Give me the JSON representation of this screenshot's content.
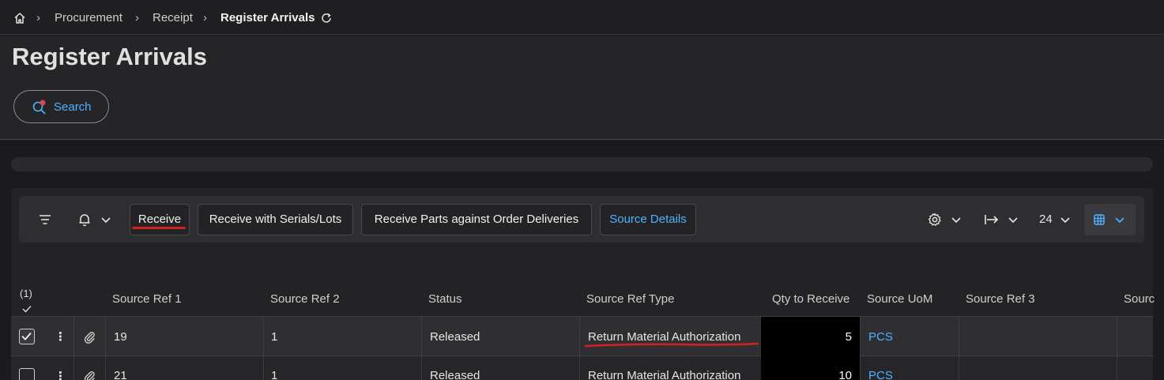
{
  "breadcrumb": {
    "items": [
      "Procurement",
      "Receipt"
    ],
    "current": "Register Arrivals"
  },
  "page": {
    "title": "Register Arrivals"
  },
  "search": {
    "label": "Search"
  },
  "toolbar": {
    "receive": "Receive",
    "receive_serials": "Receive with Serials/Lots",
    "receive_parts": "Receive Parts against Order Deliveries",
    "source_details": "Source Details",
    "page_size": "24"
  },
  "grid": {
    "selected_count": "(1)",
    "columns": [
      "Source Ref 1",
      "Source Ref 2",
      "Status",
      "Source Ref Type",
      "Qty to Receive",
      "Source UoM",
      "Source Ref 3",
      "Sourc"
    ],
    "rows": [
      {
        "checked": true,
        "source_ref_1": "19",
        "source_ref_2": "1",
        "status": "Released",
        "source_ref_type": "Return Material Authorization",
        "qty_to_receive": "5",
        "source_uom": "PCS",
        "source_ref_3": ""
      },
      {
        "checked": false,
        "source_ref_1": "21",
        "source_ref_2": "1",
        "status": "Released",
        "source_ref_type": "Return Material Authorization",
        "qty_to_receive": "10",
        "source_uom": "PCS",
        "source_ref_3": ""
      }
    ]
  },
  "colors": {
    "accent": "#4db3ff",
    "annotation": "#d32020",
    "background": "#1b1b1d"
  }
}
